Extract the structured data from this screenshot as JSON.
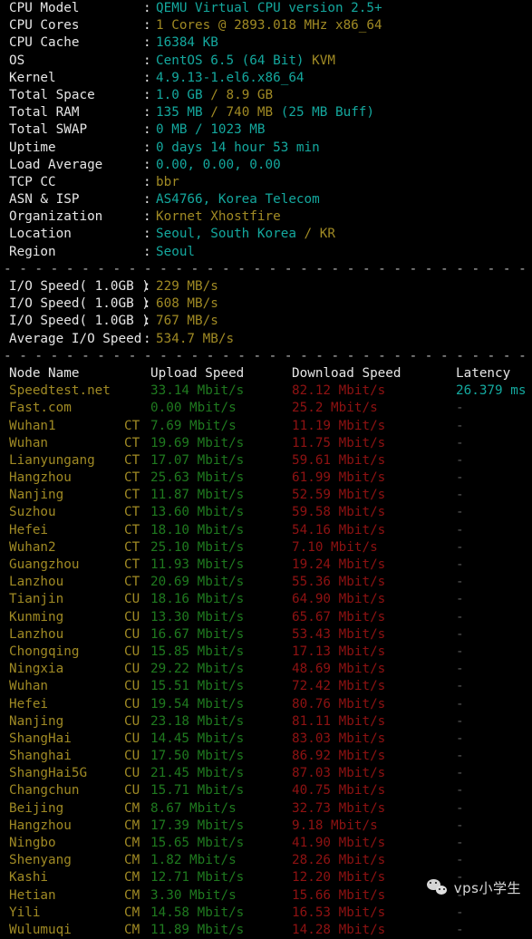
{
  "terminal": {
    "background": "#000000",
    "colors": {
      "label": "#e6e6e6",
      "cyan": "#14a89e",
      "yellow": "#a08a24",
      "green": "#1f7a1f",
      "red": "#8f1212",
      "separator": "#bcbcbc"
    },
    "separator_line": "- - - - - - - - - - - - - - - - - - - - - - - - - - - - - - - - - - - - - - - - - - - - - - - - - - - - - - - - - -"
  },
  "system_info": [
    {
      "label": "CPU Model",
      "colon": ":",
      "parts": [
        {
          "text": "QEMU Virtual CPU version 2.5+",
          "color": "cyan"
        }
      ]
    },
    {
      "label": "CPU Cores",
      "colon": ":",
      "parts": [
        {
          "text": "1 Cores @ 2893.018 MHz x86_64",
          "color": "yellow"
        }
      ]
    },
    {
      "label": "CPU Cache",
      "colon": ":",
      "parts": [
        {
          "text": "16384 KB",
          "color": "cyan"
        }
      ]
    },
    {
      "label": "OS",
      "colon": ":",
      "parts": [
        {
          "text": "CentOS 6.5 (64 Bit) ",
          "color": "cyan"
        },
        {
          "text": "KVM",
          "color": "yellow"
        }
      ]
    },
    {
      "label": "Kernel",
      "colon": ":",
      "parts": [
        {
          "text": "4.9.13-1.el6.x86_64",
          "color": "cyan"
        }
      ]
    },
    {
      "label": "Total Space",
      "colon": ":",
      "parts": [
        {
          "text": "1.0 GB ",
          "color": "cyan"
        },
        {
          "text": "/ 8.9 GB",
          "color": "yellow"
        }
      ]
    },
    {
      "label": "Total RAM",
      "colon": ":",
      "parts": [
        {
          "text": "135 MB ",
          "color": "cyan"
        },
        {
          "text": "/ 740 MB ",
          "color": "yellow"
        },
        {
          "text": "(25 MB Buff)",
          "color": "cyan"
        }
      ]
    },
    {
      "label": "Total SWAP",
      "colon": ":",
      "parts": [
        {
          "text": "0 MB / 1023 MB",
          "color": "cyan"
        }
      ]
    },
    {
      "label": "Uptime",
      "colon": ":",
      "parts": [
        {
          "text": "0 days 14 hour 53 min",
          "color": "cyan"
        }
      ]
    },
    {
      "label": "Load Average",
      "colon": ":",
      "parts": [
        {
          "text": "0.00, 0.00, 0.00",
          "color": "cyan"
        }
      ]
    },
    {
      "label": "TCP CC",
      "colon": ":",
      "parts": [
        {
          "text": "bbr",
          "color": "yellow"
        }
      ]
    },
    {
      "label": "ASN & ISP",
      "colon": ":",
      "parts": [
        {
          "text": "AS4766, Korea Telecom",
          "color": "cyan"
        }
      ]
    },
    {
      "label": "Organization",
      "colon": ":",
      "parts": [
        {
          "text": "Kornet Xhostfire",
          "color": "yellow"
        }
      ]
    },
    {
      "label": "Location",
      "colon": ":",
      "parts": [
        {
          "text": "Seoul, South Korea ",
          "color": "cyan"
        },
        {
          "text": "/ KR",
          "color": "yellow"
        }
      ]
    },
    {
      "label": "Region",
      "colon": ":",
      "parts": [
        {
          "text": "Seoul",
          "color": "cyan"
        }
      ]
    }
  ],
  "io_speed": [
    {
      "label": "I/O Speed( 1.0GB )",
      "colon": ":",
      "parts": [
        {
          "text": "229 MB/s",
          "color": "yellow"
        }
      ]
    },
    {
      "label": "I/O Speed( 1.0GB )",
      "colon": ":",
      "parts": [
        {
          "text": "608 MB/s",
          "color": "yellow"
        }
      ]
    },
    {
      "label": "I/O Speed( 1.0GB )",
      "colon": ":",
      "parts": [
        {
          "text": "767 MB/s",
          "color": "yellow"
        }
      ]
    },
    {
      "label": "Average I/O Speed",
      "colon": ":",
      "parts": [
        {
          "text": "534.7 MB/s",
          "color": "yellow"
        }
      ]
    }
  ],
  "speedtest": {
    "headers": {
      "node": "Node Name",
      "upload": "Upload Speed",
      "download": "Download Speed",
      "latency": "Latency"
    },
    "rows": [
      {
        "node": "Speedtest.net",
        "isp": "",
        "upload": "33.14 Mbit/s",
        "download": "82.12 Mbit/s",
        "latency": "26.379 ms"
      },
      {
        "node": "Fast.com",
        "isp": "",
        "upload": "0.00 Mbit/s",
        "download": "25.2 Mbit/s",
        "latency": "-"
      },
      {
        "node": "Wuhan1",
        "isp": "CT",
        "upload": "7.69 Mbit/s",
        "download": "11.19 Mbit/s",
        "latency": "-"
      },
      {
        "node": "Wuhan",
        "isp": "CT",
        "upload": "19.69 Mbit/s",
        "download": "11.75 Mbit/s",
        "latency": "-"
      },
      {
        "node": "Lianyungang",
        "isp": "CT",
        "upload": "17.07 Mbit/s",
        "download": "59.61 Mbit/s",
        "latency": "-"
      },
      {
        "node": "Hangzhou",
        "isp": "CT",
        "upload": "25.63 Mbit/s",
        "download": "61.99 Mbit/s",
        "latency": "-"
      },
      {
        "node": "Nanjing",
        "isp": "CT",
        "upload": "11.87 Mbit/s",
        "download": "52.59 Mbit/s",
        "latency": "-"
      },
      {
        "node": "Suzhou",
        "isp": "CT",
        "upload": "13.60 Mbit/s",
        "download": "59.58 Mbit/s",
        "latency": "-"
      },
      {
        "node": "Hefei",
        "isp": "CT",
        "upload": "18.10 Mbit/s",
        "download": "54.16 Mbit/s",
        "latency": "-"
      },
      {
        "node": "Wuhan2",
        "isp": "CT",
        "upload": "25.10 Mbit/s",
        "download": "7.10 Mbit/s",
        "latency": "-"
      },
      {
        "node": "Guangzhou",
        "isp": "CT",
        "upload": "11.93 Mbit/s",
        "download": "19.24 Mbit/s",
        "latency": "-"
      },
      {
        "node": "Lanzhou",
        "isp": "CT",
        "upload": "20.69 Mbit/s",
        "download": "55.36 Mbit/s",
        "latency": "-"
      },
      {
        "node": "Tianjin",
        "isp": "CU",
        "upload": "18.16 Mbit/s",
        "download": "64.90 Mbit/s",
        "latency": "-"
      },
      {
        "node": "Kunming",
        "isp": "CU",
        "upload": "13.30 Mbit/s",
        "download": "65.67 Mbit/s",
        "latency": "-"
      },
      {
        "node": "Lanzhou",
        "isp": "CU",
        "upload": "16.67 Mbit/s",
        "download": "53.43 Mbit/s",
        "latency": "-"
      },
      {
        "node": "Chongqing",
        "isp": "CU",
        "upload": "15.85 Mbit/s",
        "download": "17.13 Mbit/s",
        "latency": "-"
      },
      {
        "node": "Ningxia",
        "isp": "CU",
        "upload": "29.22 Mbit/s",
        "download": "48.69 Mbit/s",
        "latency": "-"
      },
      {
        "node": "Wuhan",
        "isp": "CU",
        "upload": "15.51 Mbit/s",
        "download": "72.42 Mbit/s",
        "latency": "-"
      },
      {
        "node": "Hefei",
        "isp": "CU",
        "upload": "19.54 Mbit/s",
        "download": "80.76 Mbit/s",
        "latency": "-"
      },
      {
        "node": "Nanjing",
        "isp": "CU",
        "upload": "23.18 Mbit/s",
        "download": "81.11 Mbit/s",
        "latency": "-"
      },
      {
        "node": "ShangHai",
        "isp": "CU",
        "upload": "14.45 Mbit/s",
        "download": "83.03 Mbit/s",
        "latency": "-"
      },
      {
        "node": "Shanghai",
        "isp": "CU",
        "upload": "17.50 Mbit/s",
        "download": "86.92 Mbit/s",
        "latency": "-"
      },
      {
        "node": "ShangHai5G",
        "isp": "CU",
        "upload": "21.45 Mbit/s",
        "download": "87.03 Mbit/s",
        "latency": "-"
      },
      {
        "node": "Changchun",
        "isp": "CU",
        "upload": "15.71 Mbit/s",
        "download": "40.75 Mbit/s",
        "latency": "-"
      },
      {
        "node": "Beijing",
        "isp": "CM",
        "upload": "8.67 Mbit/s",
        "download": "32.73 Mbit/s",
        "latency": "-"
      },
      {
        "node": "Hangzhou",
        "isp": "CM",
        "upload": "17.39 Mbit/s",
        "download": "9.18 Mbit/s",
        "latency": "-"
      },
      {
        "node": "Ningbo",
        "isp": "CM",
        "upload": "15.65 Mbit/s",
        "download": "41.90 Mbit/s",
        "latency": "-"
      },
      {
        "node": "Shenyang",
        "isp": "CM",
        "upload": "1.82 Mbit/s",
        "download": "28.26 Mbit/s",
        "latency": "-"
      },
      {
        "node": "Kashi",
        "isp": "CM",
        "upload": "12.71 Mbit/s",
        "download": "12.20 Mbit/s",
        "latency": "-"
      },
      {
        "node": "Hetian",
        "isp": "CM",
        "upload": "3.30 Mbit/s",
        "download": "15.66 Mbit/s",
        "latency": "-"
      },
      {
        "node": "Yili",
        "isp": "CM",
        "upload": "14.58 Mbit/s",
        "download": "16.53 Mbit/s",
        "latency": "-"
      },
      {
        "node": "Wulumuqi",
        "isp": "CM",
        "upload": "11.89 Mbit/s",
        "download": "14.28 Mbit/s",
        "latency": "-"
      }
    ]
  },
  "watermark": {
    "text": "vps小学生",
    "icon": "wechat-icon"
  }
}
